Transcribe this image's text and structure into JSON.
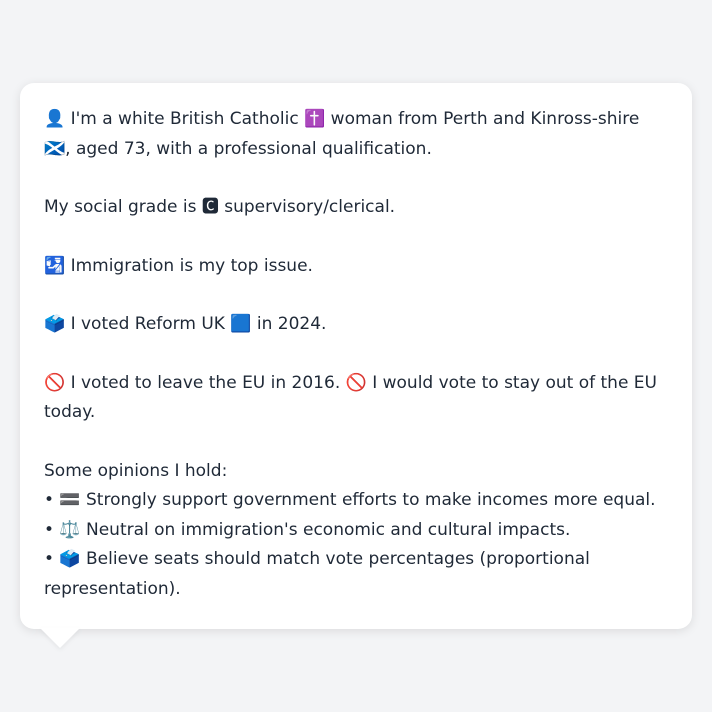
{
  "card": {
    "intro_line": "👤 I'm a white British Catholic ✝️ woman from Perth and Kinross-shire 🏴󠁧󠁢󠁳󠁣󠁴󠁿, aged 73, with a professional qualification.",
    "social_grade_line": "My social grade is 🅲 supervisory/clerical.",
    "top_issue_line": "🛂 Immigration is my top issue.",
    "vote_2024_line": "🗳️ I voted Reform UK 🟦 in 2024.",
    "eu_line": "🚫 I voted to leave the EU in 2016. 🚫 I would vote to stay out of the EU today.",
    "opinions_heading": "Some opinions I hold:",
    "opinions": [
      "• 🟰 Strongly support government efforts to make incomes more equal.",
      "• ⚖️ Neutral on immigration's economic and cultural impacts.",
      "• 🗳️ Believe seats should match vote percentages (proportional representation)."
    ]
  }
}
